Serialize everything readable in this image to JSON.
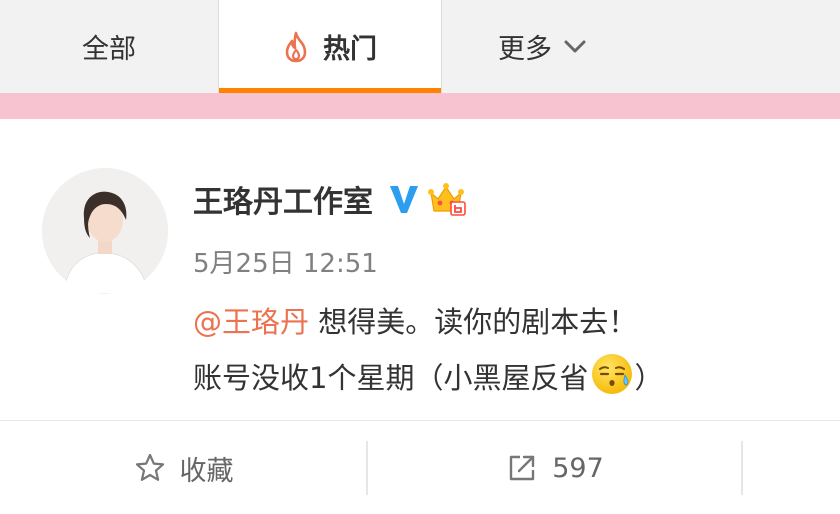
{
  "tabs": [
    {
      "label": "全部",
      "active": false
    },
    {
      "label": "热门",
      "active": true,
      "icon": "flame-icon"
    },
    {
      "label": "更多",
      "active": false,
      "icon": "chevron-down-icon"
    }
  ],
  "colors": {
    "accent": "#ff8200",
    "mention": "#eb7350",
    "verified": "#2c9ef0",
    "band": "#f8c3d0",
    "tab_bar": "#f2f2f2"
  },
  "post": {
    "author": "王珞丹工作室",
    "verified_icon": "verified-v-icon",
    "member_icon": "crown-icon",
    "time": "5月25日 12:51",
    "mention": "@王珞丹",
    "text_line1": "想得美。读你的剧本去！",
    "text_line2": "账号没收1个星期（小黑屋反省",
    "emoji": "sweat-emoji",
    "text_close": "）"
  },
  "actions": {
    "favorite_label": "收藏",
    "favorite_icon": "star-icon",
    "share_count": "597",
    "share_icon": "share-icon"
  }
}
